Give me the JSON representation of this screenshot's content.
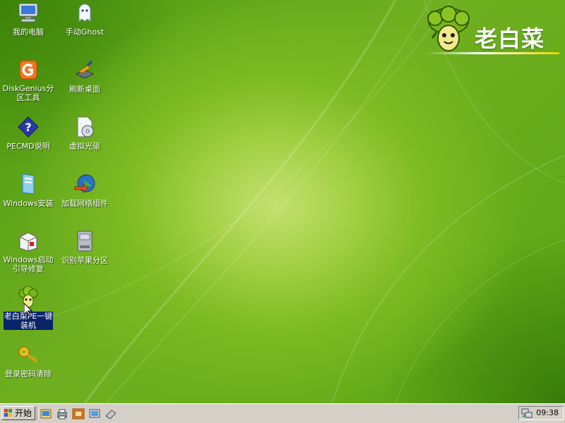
{
  "desktop": {
    "brand": {
      "name": "老白菜"
    },
    "icons": [
      {
        "label": "我的电脑",
        "icon": "my-computer-icon"
      },
      {
        "label": "手动Ghost",
        "icon": "ghost-icon"
      },
      {
        "label": "DiskGenius分\n区工具",
        "icon": "diskgenius-icon"
      },
      {
        "label": "刷新桌面",
        "icon": "refresh-desktop-icon"
      },
      {
        "label": "PECMD说明",
        "icon": "help-icon"
      },
      {
        "label": "虚拟光驱",
        "icon": "virtual-cd-icon"
      },
      {
        "label": "Windows安装",
        "icon": "windows-install-icon"
      },
      {
        "label": "加载网络组件",
        "icon": "network-globe-icon"
      },
      {
        "label": "Windows启动\n引导修复",
        "icon": "boot-repair-icon"
      },
      {
        "label": "识别苹果分区",
        "icon": "drive-icon"
      },
      {
        "label": "老白菜PE一键\n装机",
        "icon": "laobaicai-installer-icon",
        "selected": true
      },
      {
        "label": "登录密码清除",
        "icon": "key-icon"
      }
    ]
  },
  "taskbar": {
    "start_label": "开始",
    "quick_launch": [
      "explorer-icon",
      "printer-icon",
      "folder-icon",
      "display-icon",
      "eraser-icon"
    ],
    "tray_icon": "network-tray-icon",
    "clock": "09:38"
  },
  "colors": {
    "desktop_green": "#7cba22",
    "taskbar_gray": "#d4d0c8",
    "selection_blue": "#0a246a"
  }
}
